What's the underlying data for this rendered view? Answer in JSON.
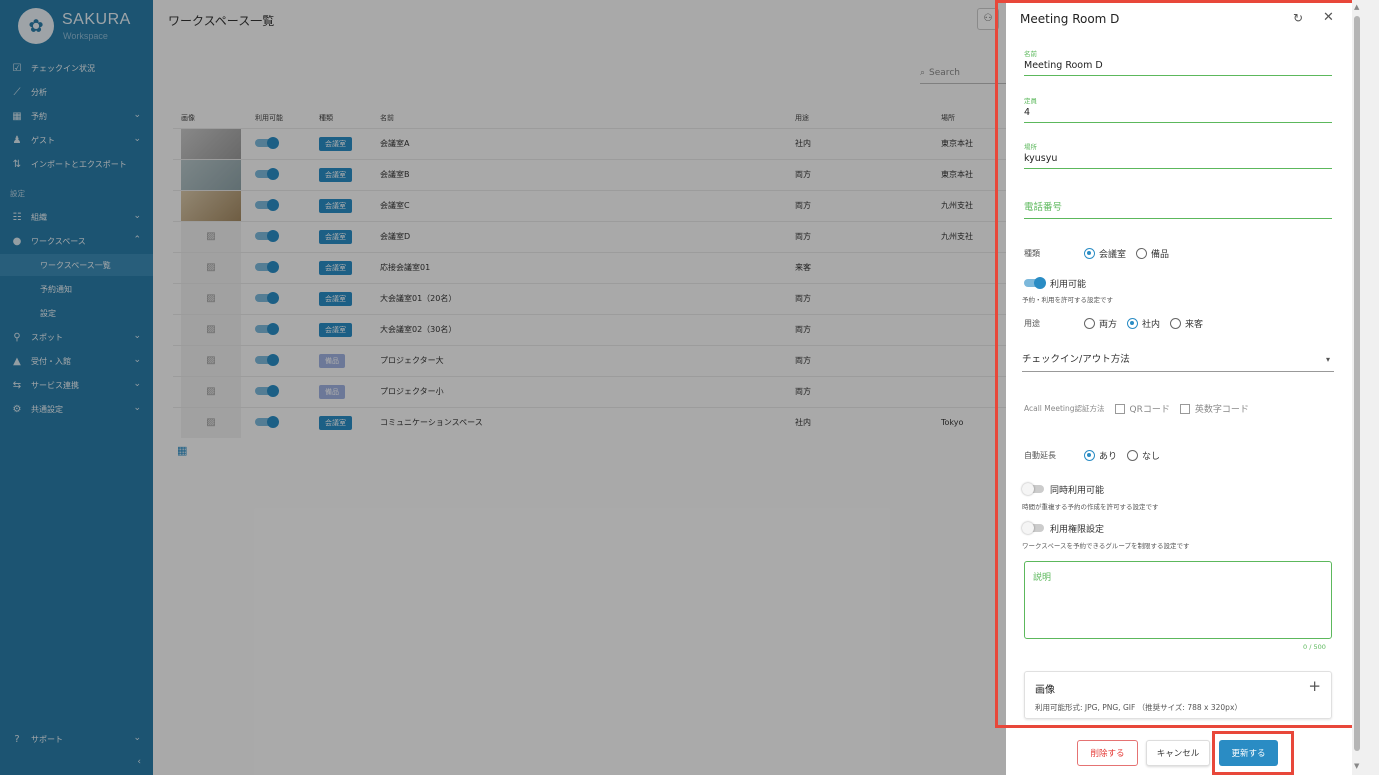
{
  "sidebar": {
    "brand": "SAKURA",
    "brand_sub": "Workspace",
    "logo_icon": "sakura-flower-icon",
    "section_settings": "設定",
    "items": [
      {
        "label": "チェックイン状況",
        "icon": "checkbox-icon"
      },
      {
        "label": "分析",
        "icon": "chart-icon"
      },
      {
        "label": "予約",
        "icon": "calendar-icon"
      },
      {
        "label": "ゲスト",
        "icon": "person-icon"
      },
      {
        "label": "インポートとエクスポート",
        "icon": "import-export-icon"
      },
      {
        "label": "組織",
        "icon": "group-icon"
      },
      {
        "label": "ワークスペース",
        "icon": "location-pin-icon"
      },
      {
        "label": "ワークスペース一覧"
      },
      {
        "label": "予約通知"
      },
      {
        "label": "設定"
      },
      {
        "label": "スポット",
        "icon": "pin-icon"
      },
      {
        "label": "受付・入館",
        "icon": "building-icon"
      },
      {
        "label": "サービス連携",
        "icon": "integration-icon"
      },
      {
        "label": "共通設定",
        "icon": "settings-icon"
      }
    ],
    "support": "サポート"
  },
  "main": {
    "title": "ワークスペース一覧",
    "search_placeholder": "Search",
    "columns": [
      "画像",
      "利用可能",
      "種類",
      "名前",
      "用途",
      "場所"
    ],
    "rows": [
      {
        "type": "会議室",
        "name": "会議室A",
        "usage": "社内",
        "place": "東京本社"
      },
      {
        "type": "会議室",
        "name": "会議室B",
        "usage": "両方",
        "place": "東京本社"
      },
      {
        "type": "会議室",
        "name": "会議室C",
        "usage": "両方",
        "place": "九州支社"
      },
      {
        "type": "会議室",
        "name": "会議室D",
        "usage": "両方",
        "place": "九州支社"
      },
      {
        "type": "会議室",
        "name": "応接会議室01",
        "usage": "来客",
        "place": ""
      },
      {
        "type": "会議室",
        "name": "大会議室01（20名）",
        "usage": "両方",
        "place": ""
      },
      {
        "type": "会議室",
        "name": "大会議室02（30名）",
        "usage": "両方",
        "place": ""
      },
      {
        "type": "備品",
        "name": "プロジェクター大",
        "usage": "両方",
        "place": ""
      },
      {
        "type": "備品",
        "name": "プロジェクター小",
        "usage": "両方",
        "place": ""
      },
      {
        "type": "会議室",
        "name": "コミュニケーションスペース",
        "usage": "社内",
        "place": "Tokyo"
      }
    ]
  },
  "drawer": {
    "title": "Meeting Room D",
    "name_label": "名前",
    "name_value": "Meeting Room D",
    "capacity_label": "定員",
    "capacity_value": "4",
    "place_label": "場所",
    "place_value": "kyusyu",
    "phone_placeholder": "電話番号",
    "kind_label": "種類",
    "kind_options": [
      "会議室",
      "備品"
    ],
    "available_label": "利用可能",
    "available_hint": "予約・利用を許可する設定です",
    "usage_label": "用途",
    "usage_options": [
      "両方",
      "社内",
      "来客"
    ],
    "checkin_method": "チェックイン/アウト方法",
    "acall_label": "Acall Meeting認証方法",
    "acall_options": [
      "QRコード",
      "英数字コード"
    ],
    "auto_extend_label": "自動延長",
    "auto_extend_options": [
      "あり",
      "なし"
    ],
    "concurrent_label": "同時利用可能",
    "concurrent_hint": "時間が重複する予約の作成を許可する設定です",
    "permission_label": "利用権限設定",
    "permission_hint": "ワークスペースを予約できるグループを制限する設定です",
    "description_placeholder": "説明",
    "counter": "0 / 500",
    "image_title": "画像",
    "image_hint": "利用可能形式: JPG, PNG, GIF （推奨サイズ: 788 x 320px）",
    "delete_label": "削除する",
    "cancel_label": "キャンセル",
    "update_label": "更新する"
  },
  "colors": {
    "sidebar": "#2a7ca8",
    "accent": "#2a8cc4",
    "valid": "#5cb85c",
    "highlight": "#e8473a",
    "danger": "#e53935"
  }
}
